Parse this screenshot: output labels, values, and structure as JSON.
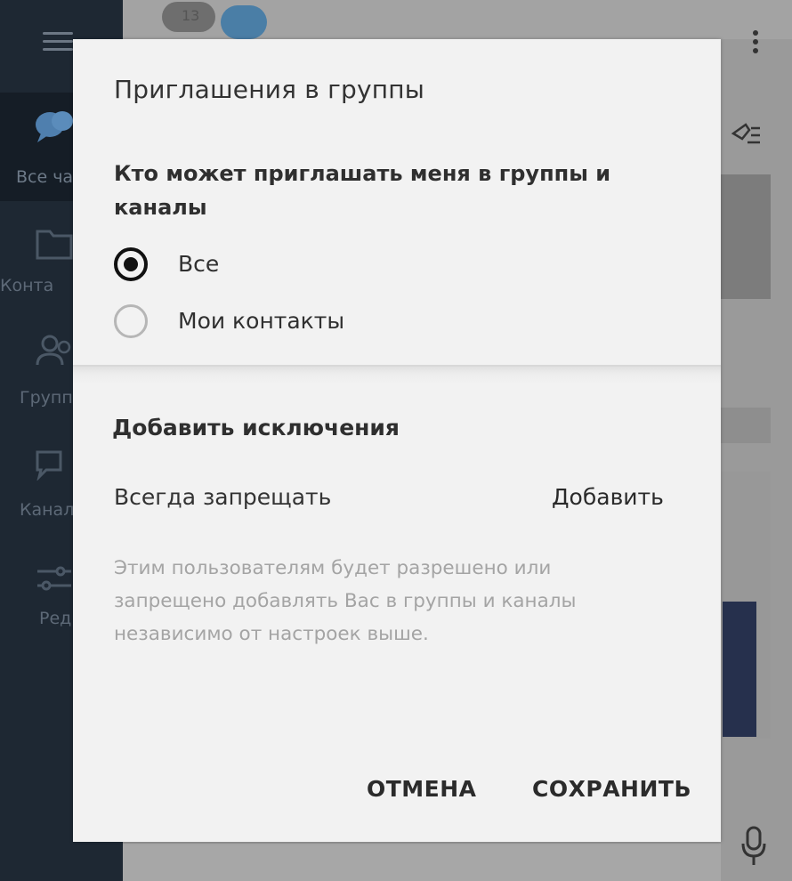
{
  "sidebar": {
    "items": [
      {
        "label": "Все ча",
        "icon": "chat-bubbles-icon",
        "active": true
      },
      {
        "label": "Конта",
        "icon": "folder-icon"
      },
      {
        "label": "Группы",
        "icon": "people-icon"
      },
      {
        "label": "Канал",
        "icon": "channel-icon"
      },
      {
        "label": "Ред",
        "icon": "sliders-icon"
      }
    ]
  },
  "topbar": {
    "avatar_a_text": "13"
  },
  "dialog": {
    "title": "Приглашения в группы",
    "question": "Кто может приглашать меня в группы и каналы",
    "options": [
      {
        "label": "Все",
        "checked": true
      },
      {
        "label": "Мои контакты",
        "checked": false
      }
    ],
    "exceptions_title": "Добавить исключения",
    "always_deny_label": "Всегда запрещать",
    "add_label": "Добавить",
    "hint": "Этим пользователям будет разрешено или запрещено добавлять Вас в группы и каналы независимо от настроек выше.",
    "cancel_label": "ОТМЕНА",
    "save_label": "СОХРАНИТЬ"
  },
  "colors": {
    "sidebar_bg": "#1e2833",
    "dialog_bg": "#f2f2f2",
    "text_dark": "#333333",
    "hint_text": "#a4a4a4"
  }
}
